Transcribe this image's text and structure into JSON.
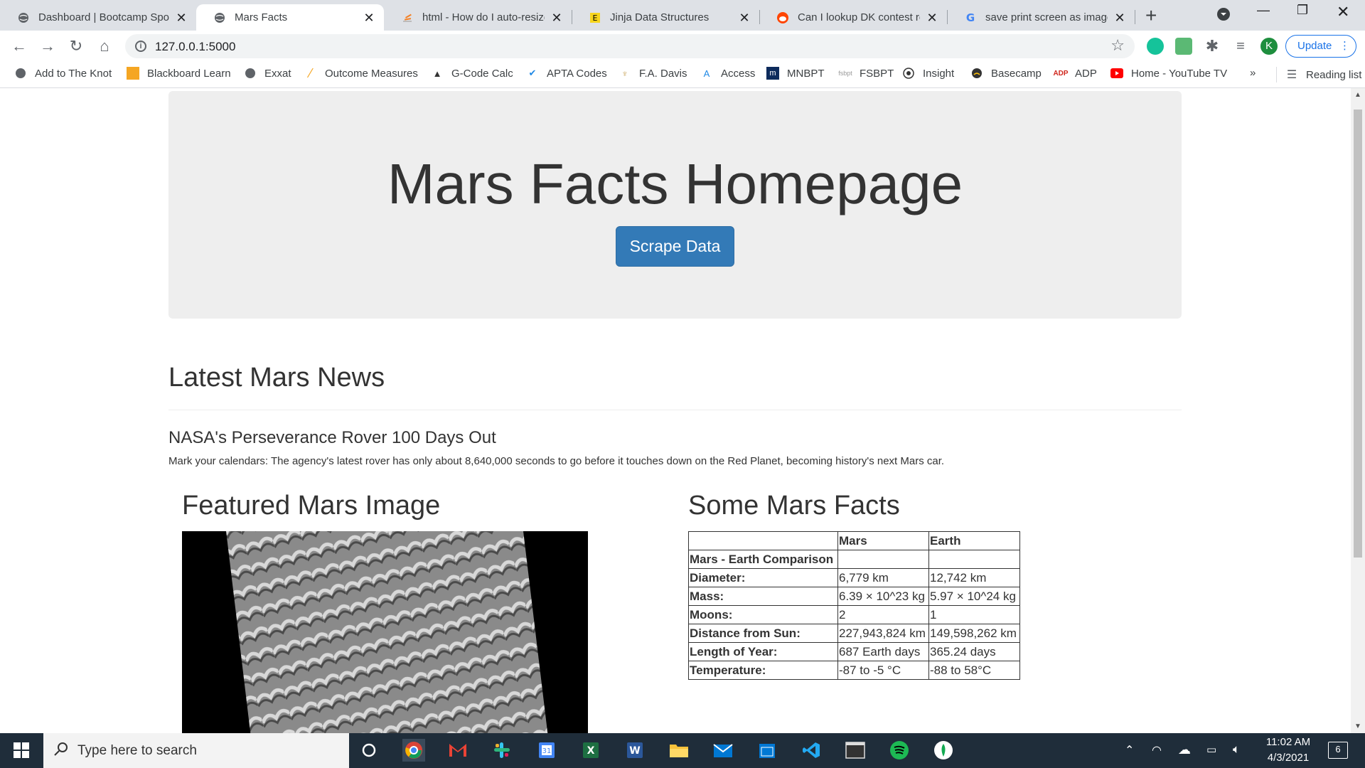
{
  "browser": {
    "tabs": [
      {
        "title": "Dashboard | Bootcamp Spot",
        "icon": "globe-icon"
      },
      {
        "title": "Mars Facts",
        "icon": "globe-icon"
      },
      {
        "title": "html - How do I auto-resize",
        "icon": "stackoverflow-icon"
      },
      {
        "title": "Jinja Data Structures",
        "icon": "jinja-icon"
      },
      {
        "title": "Can I lookup DK contest res",
        "icon": "reddit-icon"
      },
      {
        "title": "save print screen as image",
        "icon": "google-icon"
      }
    ],
    "url": "127.0.0.1:5000",
    "profile_initial": "K",
    "update_label": "Update"
  },
  "bookmarks": {
    "items": [
      "Add to The Knot",
      "Blackboard Learn",
      "Exxat",
      "Outcome Measures",
      "G-Code Calc",
      "APTA Codes",
      "F.A. Davis",
      "Access",
      "MNBPT",
      "FSBPT",
      "Insight",
      "Basecamp",
      "ADP",
      "Home - YouTube TV"
    ],
    "more": "»",
    "reading_list": "Reading list"
  },
  "page": {
    "title": "Mars Facts Homepage",
    "scrape_button": "Scrape Data",
    "news_heading": "Latest Mars News",
    "news_title": "NASA's Perseverance Rover 100 Days Out",
    "news_body": "Mark your calendars: The agency's latest rover has only about 8,640,000 seconds to go before it touches down on the Red Planet, becoming history's next Mars car.",
    "featured_heading": "Featured Mars Image",
    "facts_heading": "Some Mars Facts",
    "facts_table": {
      "headers": [
        "",
        "Mars",
        "Earth"
      ],
      "rows": [
        [
          "Mars - Earth Comparison",
          "",
          ""
        ],
        [
          "Diameter:",
          "6,779 km",
          "12,742 km"
        ],
        [
          "Mass:",
          "6.39 × 10^23 kg",
          "5.97 × 10^24 kg"
        ],
        [
          "Moons:",
          "2",
          "1"
        ],
        [
          "Distance from Sun:",
          "227,943,824 km",
          "149,598,262 km"
        ],
        [
          "Length of Year:",
          "687 Earth days",
          "365.24 days"
        ],
        [
          "Temperature:",
          "-87 to -5 °C",
          "-88 to 58°C"
        ]
      ]
    }
  },
  "taskbar": {
    "search_placeholder": "Type here to search",
    "time": "11:02 AM",
    "date": "4/3/2021",
    "notification_count": "6"
  }
}
